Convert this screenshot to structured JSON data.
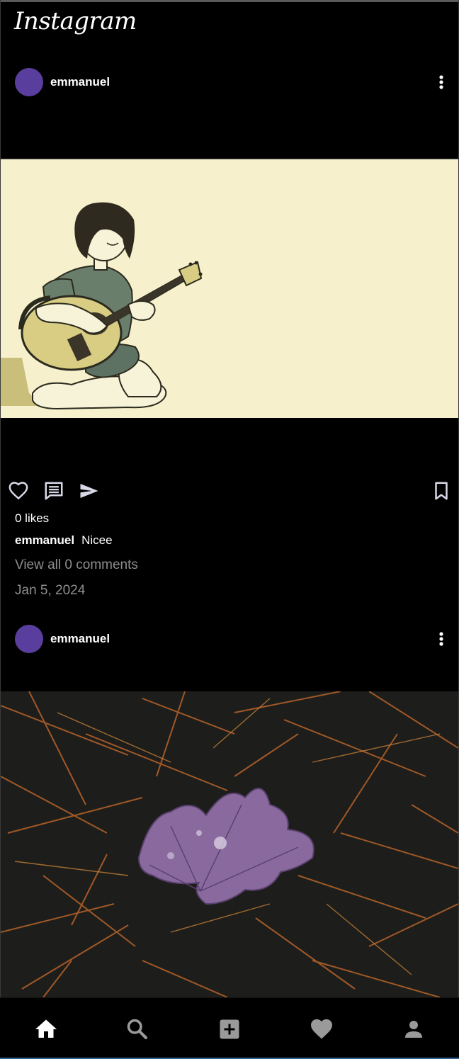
{
  "app": {
    "logo_text": "Instagram"
  },
  "posts": [
    {
      "username": "emmanuel",
      "likes_text": "0 likes",
      "caption_user": "emmanuel",
      "caption_text": "Nicee",
      "view_comments_text": "View all 0 comments",
      "date_text": "Jan 5, 2024",
      "image_subject": "girl-playing-guitar-illustration"
    },
    {
      "username": "emmanuel",
      "image_subject": "purple-leaf-on-pine-needles-photo"
    }
  ],
  "actions": {
    "like_icon": "heart-outline-icon",
    "comment_icon": "comment-icon",
    "share_icon": "send-icon",
    "save_icon": "bookmark-icon"
  },
  "bottom_nav": {
    "items": [
      {
        "icon": "home-icon",
        "active": true
      },
      {
        "icon": "search-icon",
        "active": false
      },
      {
        "icon": "add-box-icon",
        "active": false
      },
      {
        "icon": "heart-icon",
        "active": false
      },
      {
        "icon": "profile-icon",
        "active": false
      }
    ]
  },
  "colors": {
    "background": "#000000",
    "avatar": "#5a3e9e",
    "secondary_text": "#8e8e8e",
    "icon": "#d8d8e8",
    "nav_icon": "#9a9a9a",
    "image1_bg": "#f6f0cc"
  }
}
